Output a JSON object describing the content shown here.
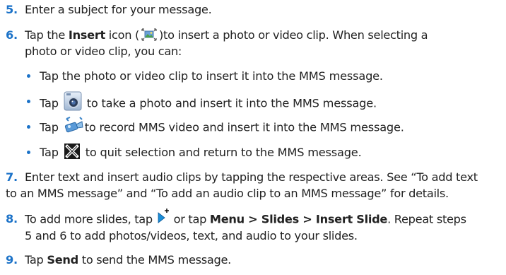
{
  "steps": [
    {
      "number": "5.",
      "text": "Enter a subject for your message."
    },
    {
      "number": "6.",
      "pre": "Tap the ",
      "bold": "Insert",
      "mid": " icon (",
      "post": ")to insert a photo or video clip. When selecting a",
      "line2": "photo or video clip, you can:"
    },
    {
      "number": "7.",
      "line1": "Enter text and insert audio clips by tapping the respective areas. See “To add text",
      "line2": "to an MMS message” and “To add an audio clip to an MMS message” for details."
    },
    {
      "number": "8.",
      "pre": "To add more slides, tap ",
      "mid": " or tap ",
      "bold": "Menu > Slides > Insert Slide",
      "post": ". Repeat steps",
      "line2": "5 and 6 to add photos/videos, text, and audio to your slides."
    },
    {
      "number": "9.",
      "pre": "Tap ",
      "bold": "Send",
      "post": " to send the MMS message."
    }
  ],
  "bullets": [
    {
      "text": "Tap the photo or video clip to insert it into the MMS message."
    },
    {
      "pre": "Tap ",
      "post": " to take a photo and insert it into the MMS message.",
      "icon": "camera-icon"
    },
    {
      "pre": "Tap ",
      "post": "to record MMS video and insert it into the MMS message.",
      "icon": "video-camera-icon"
    },
    {
      "pre": "Tap ",
      "post": " to quit selection and return to the MMS message.",
      "icon": "close-x-icon"
    }
  ],
  "icons": {
    "insert": "insert-picture-icon",
    "new_slide": "new-slide-arrow-icon"
  },
  "colors": {
    "step_number": "#1b72c8",
    "bullet": "#1b72c8",
    "text": "#222222"
  }
}
